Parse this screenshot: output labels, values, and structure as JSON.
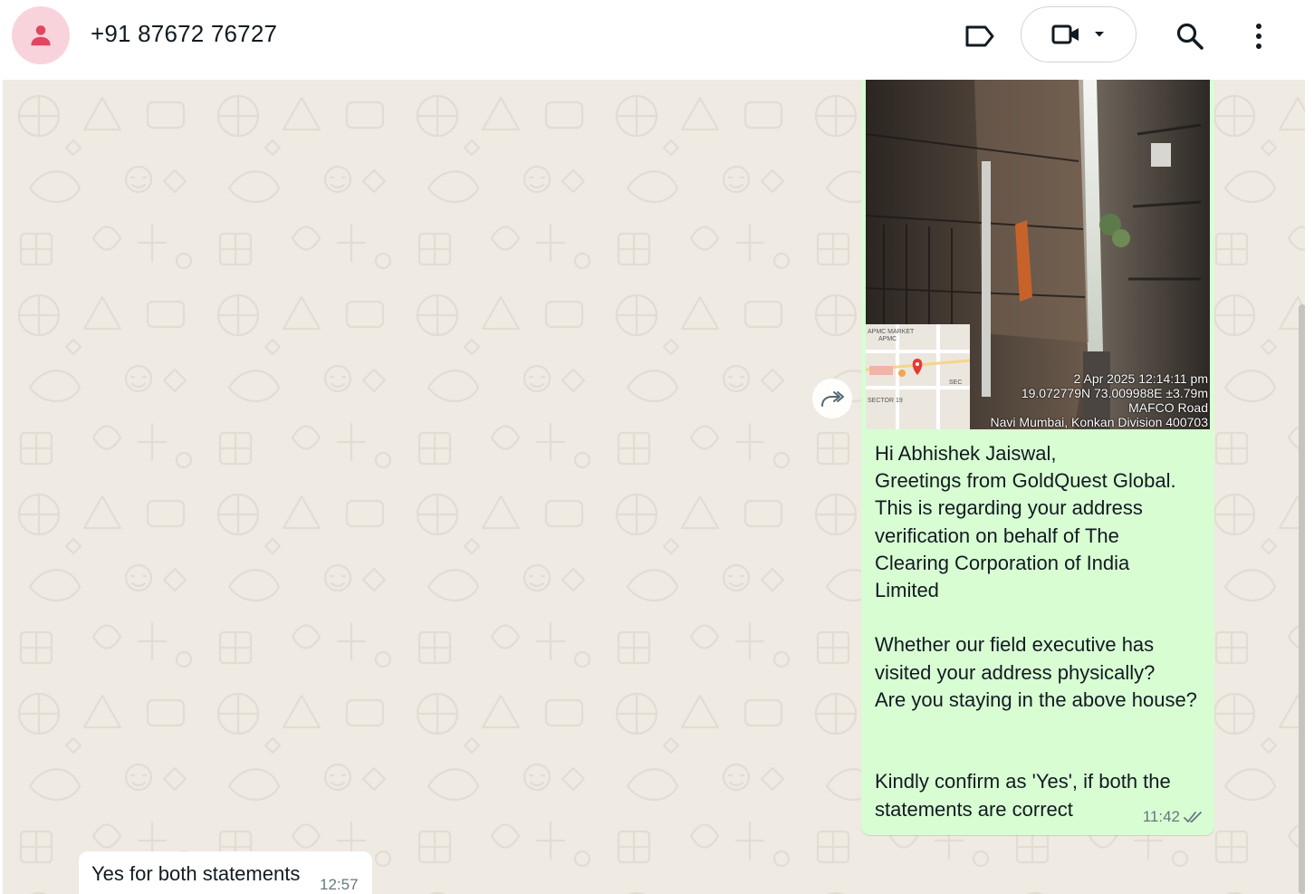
{
  "header": {
    "contact_name": "+91 87672 76727",
    "icons": [
      "person-icon",
      "label-icon",
      "video-call-icon",
      "dropdown-caret-icon",
      "search-icon",
      "more-vertical-icon"
    ]
  },
  "messages": {
    "outgoing": {
      "photo_stamp": {
        "line1": "2 Apr 2025 12:14:11 pm",
        "line2": "19.072779N 73.009988E ±3.79m",
        "line3": "MAFCO Road",
        "line4": "Navi Mumbai, Konkan Division 400703"
      },
      "minimap_labels": [
        "APMC MARKET",
        "APMC",
        "SECTOR 19",
        "SEC"
      ],
      "lines_block1": [
        "Hi Abhishek Jaiswal,",
        "Greetings from GoldQuest Global.",
        "This is regarding your address",
        "verification on behalf of The",
        "Clearing Corporation of India",
        "Limited"
      ],
      "lines_block2": [
        "Whether our field executive has",
        "visited your address physically?",
        "Are you staying in the above house?"
      ],
      "lines_block3": [
        "Kindly confirm as 'Yes', if both the",
        "statements are correct"
      ],
      "time": "11:42",
      "status_icon": "double-check-icon"
    },
    "incoming": {
      "text": "Yes for both statements",
      "time": "12:57"
    }
  },
  "colors": {
    "chat_background": "#efeae2",
    "outgoing_bubble": "#d9fdd3",
    "incoming_bubble": "#ffffff",
    "avatar_background": "#f9d3dc",
    "avatar_icon": "#e0475f"
  }
}
